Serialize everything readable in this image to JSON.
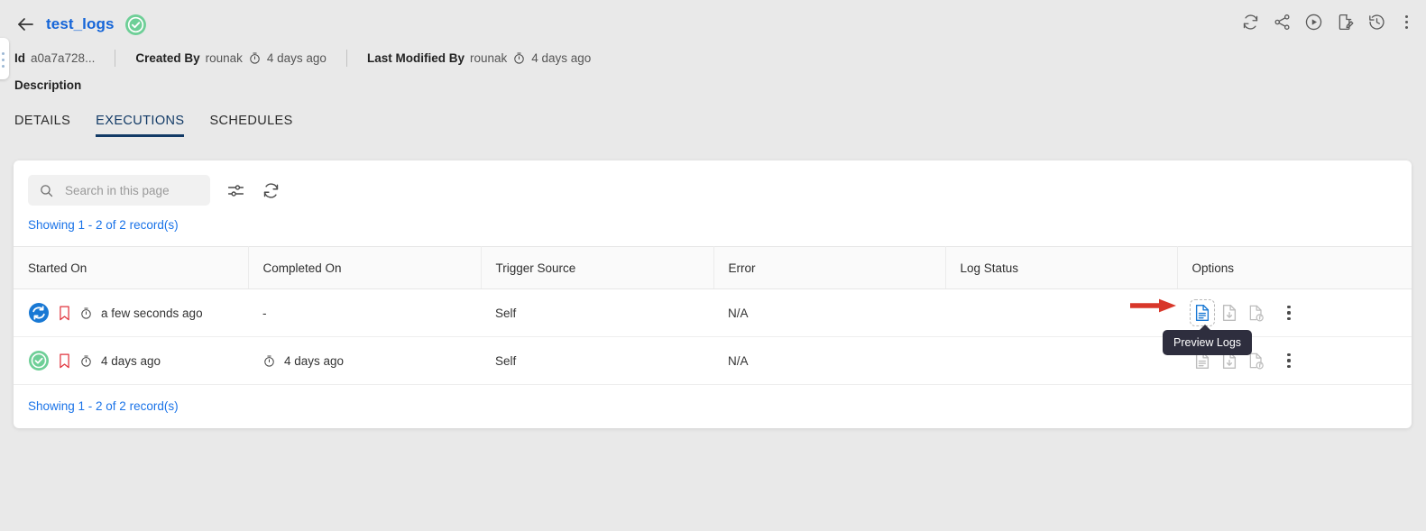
{
  "header": {
    "back_icon": "back-arrow-icon",
    "title": "test_logs",
    "status_icon": "success-check-icon",
    "actions": [
      {
        "name": "refresh-icon",
        "label": "Refresh"
      },
      {
        "name": "share-icon",
        "label": "Share"
      },
      {
        "name": "run-icon",
        "label": "Run"
      },
      {
        "name": "edit-document-icon",
        "label": "Edit"
      },
      {
        "name": "history-icon",
        "label": "History"
      },
      {
        "name": "more-options-icon",
        "label": "More"
      }
    ],
    "meta": {
      "id_label": "Id",
      "id_value": "a0a7a728...",
      "created_by_label": "Created By",
      "created_by_value": "rounak",
      "created_at": "4 days ago",
      "last_modified_by_label": "Last Modified By",
      "last_modified_by_value": "rounak",
      "last_modified_at": "4 days ago"
    },
    "description_label": "Description"
  },
  "tabs": [
    {
      "label": "DETAILS",
      "active": false
    },
    {
      "label": "EXECUTIONS",
      "active": true
    },
    {
      "label": "SCHEDULES",
      "active": false
    }
  ],
  "toolbar": {
    "search_placeholder": "Search in this page",
    "search_value": "",
    "filter_icon": "filter-settings-icon",
    "refresh_icon": "refresh-icon"
  },
  "table": {
    "record_count_top": "Showing 1 - 2 of 2 record(s)",
    "record_count_bottom": "Showing 1 - 2 of 2 record(s)",
    "columns": [
      "Started On",
      "Completed On",
      "Trigger Source",
      "Error",
      "Log Status",
      "Options"
    ],
    "rows": [
      {
        "status_icon": "running-sync-icon",
        "bookmark_icon": "bookmark-outline-icon",
        "started_on": "a few seconds ago",
        "completed_on": "-",
        "completed_on_has_clock": false,
        "trigger_source": "Self",
        "error": "N/A",
        "log_status": "",
        "options": [
          "preview-logs-icon",
          "download-logs-icon",
          "log-info-icon",
          "row-more-options-icon"
        ]
      },
      {
        "status_icon": "success-check-icon",
        "bookmark_icon": "bookmark-outline-icon",
        "started_on": "4 days ago",
        "completed_on": "4 days ago",
        "completed_on_has_clock": true,
        "trigger_source": "Self",
        "error": "N/A",
        "log_status": "",
        "options": [
          "preview-logs-icon",
          "download-logs-icon",
          "log-info-icon",
          "row-more-options-icon"
        ]
      }
    ]
  },
  "tooltip": {
    "text": "Preview Logs"
  },
  "annotation": {
    "arrow_color": "#d8372a",
    "points_to": "preview-logs-icon"
  },
  "colors": {
    "page_background": "#e9e9e9",
    "card_background": "#ffffff",
    "title_blue": "#1565d8",
    "link_blue": "#1a73e8",
    "active_tab": "#123a66",
    "running_blue": "#1878d4",
    "success_green": "#6ecf97",
    "bookmark_red": "#e0323c",
    "tooltip_background": "#2e2e3e"
  }
}
